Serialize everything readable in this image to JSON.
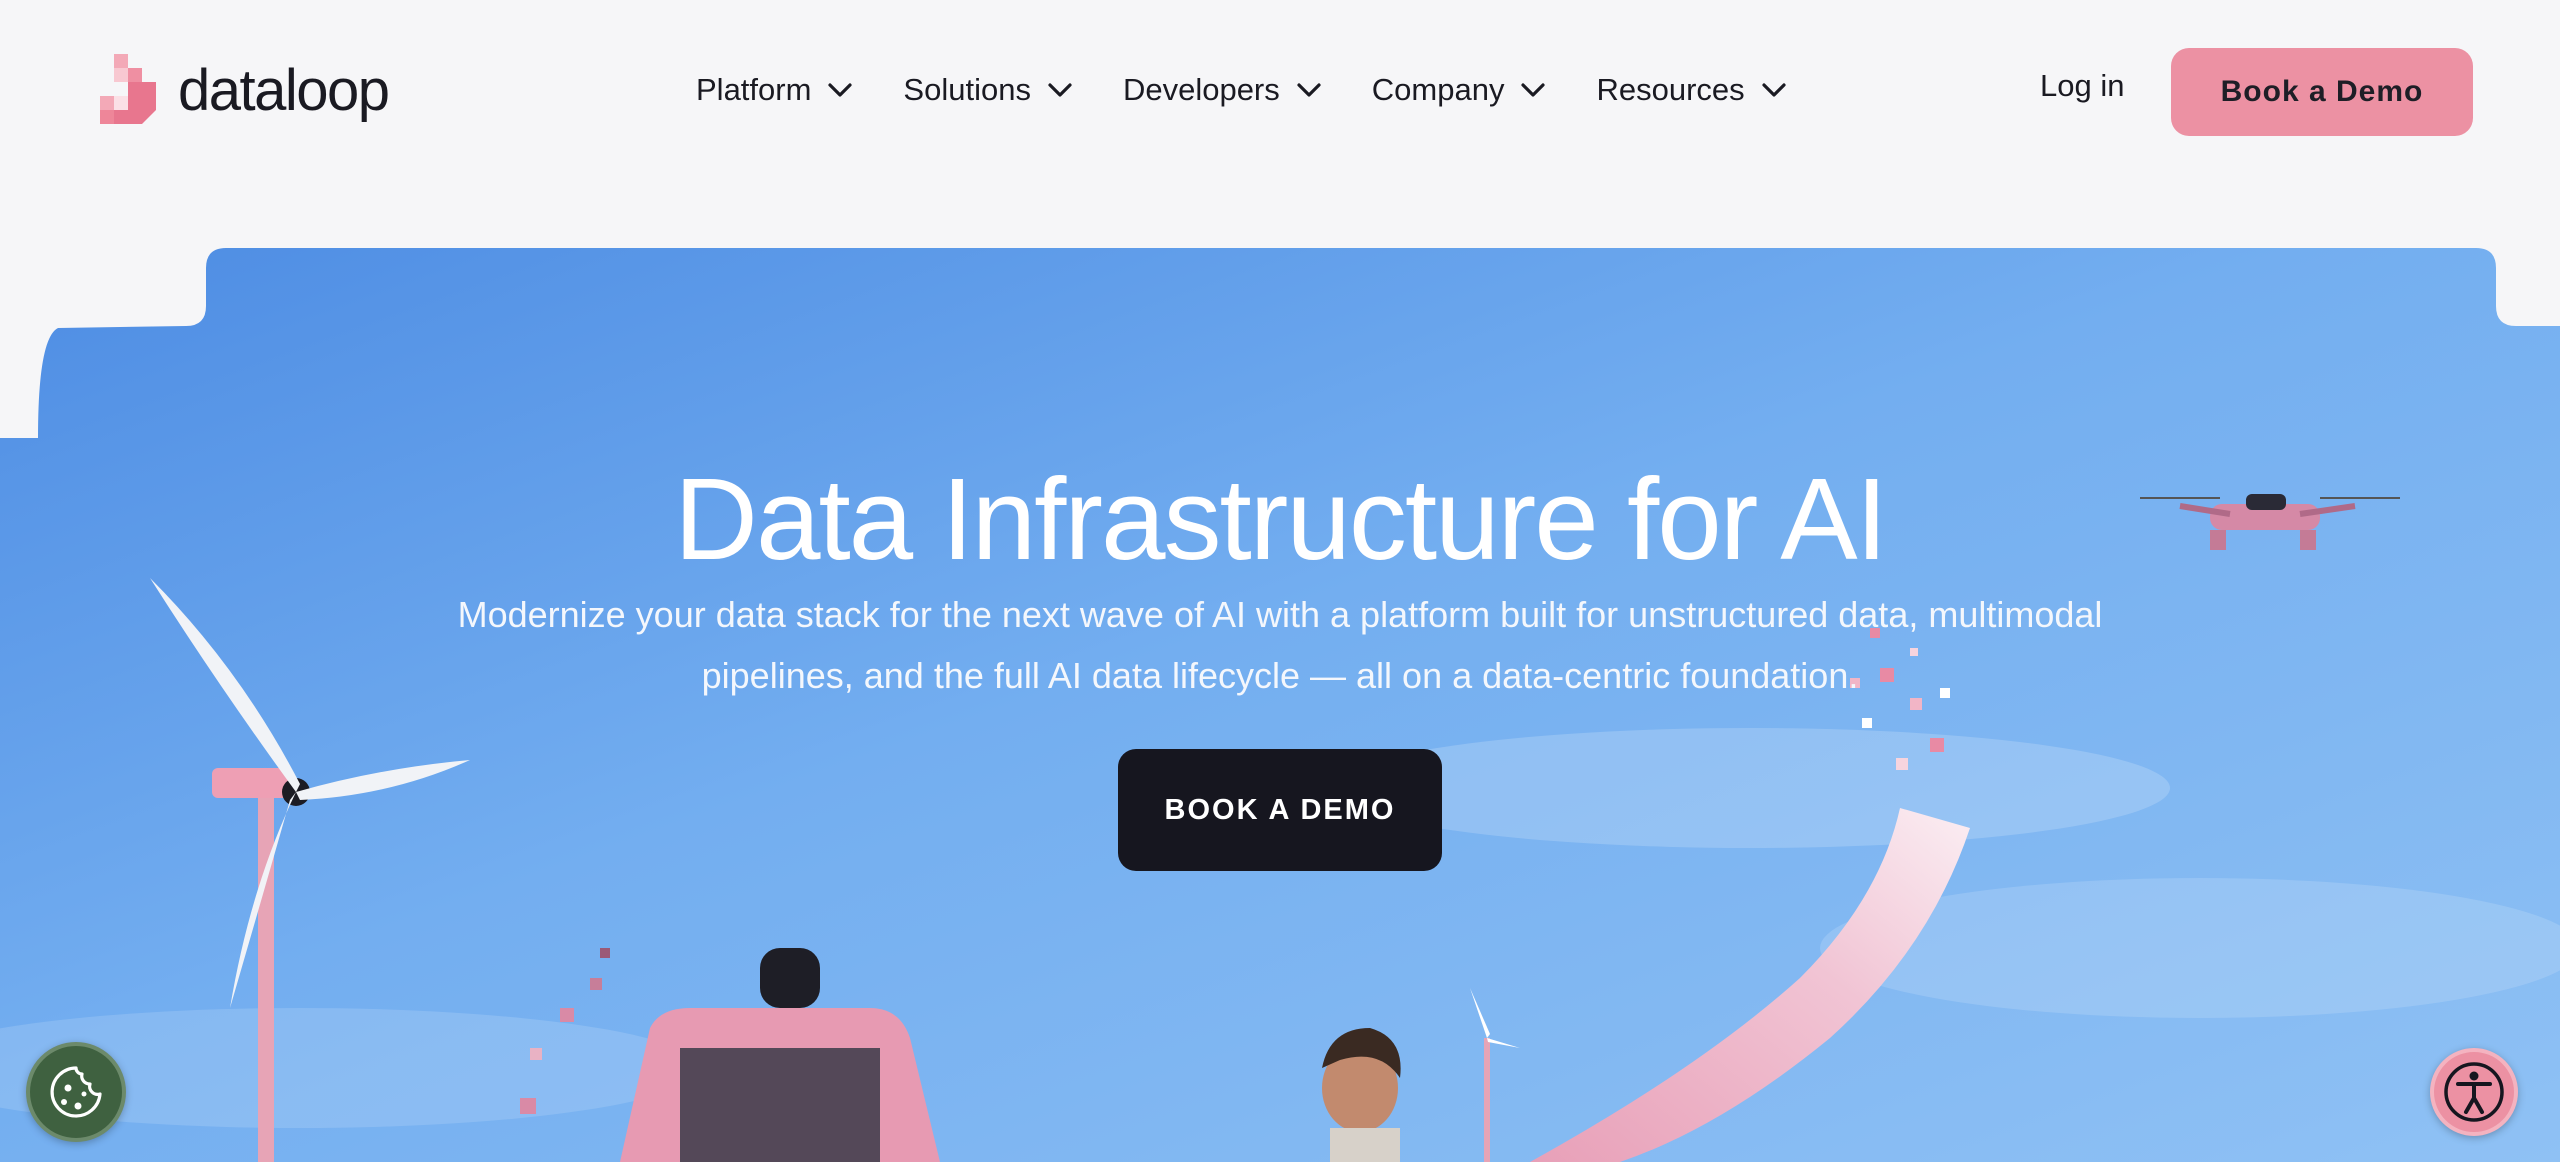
{
  "brand": {
    "name": "dataloop",
    "accent": "#ec91a3"
  },
  "nav": {
    "items": [
      {
        "label": "Platform",
        "icon": "chevron-down-icon"
      },
      {
        "label": "Solutions",
        "icon": "chevron-down-icon"
      },
      {
        "label": "Developers",
        "icon": "chevron-down-icon"
      },
      {
        "label": "Company",
        "icon": "chevron-down-icon"
      },
      {
        "label": "Resources",
        "icon": "chevron-down-icon"
      }
    ],
    "login_label": "Log in",
    "book_demo_label": "Book a Demo"
  },
  "hero": {
    "title": "Data Infrastructure for AI",
    "subtitle": "Modernize your data stack for the next wave of AI with a platform built for unstructured data, multimodal pipelines, and the full AI data lifecycle — all on a data-centric foundation.",
    "cta_label": "BOOK A DEMO",
    "cta_color": "#16161f",
    "sky_color": "#6aa6ea"
  },
  "widgets": {
    "cookie_icon": "cookie-icon",
    "cookie_color": "#3f6140",
    "accessibility_icon": "accessibility-icon"
  }
}
